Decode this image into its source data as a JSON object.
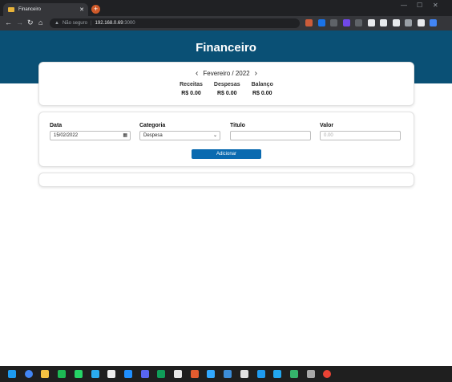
{
  "browser": {
    "tab_title": "Financeiro",
    "tab_close": "✕",
    "new_tab": "+",
    "window_controls": [
      "—",
      "☐",
      "✕"
    ],
    "nav": {
      "back": "←",
      "forward": "→",
      "reload": "↻",
      "home": "⌂"
    },
    "address": {
      "security_label": "Não seguro",
      "host": "192.168.0.69",
      "port": ":3000"
    },
    "extension_colors": [
      "#cc5c3a",
      "#1a73e8",
      "#5f6368",
      "#7048e8",
      "#5f6368",
      "#e8eaed",
      "#e8eaed",
      "#e8eaed",
      "#9aa0a6",
      "#e8eaed",
      "#4285f4"
    ]
  },
  "app": {
    "title": "Financeiro",
    "month_nav": {
      "prev": "‹",
      "label": "Fevereiro / 2022",
      "next": "›"
    },
    "summary": [
      {
        "label": "Receitas",
        "value": "R$ 0.00"
      },
      {
        "label": "Despesas",
        "value": "R$ 0.00"
      },
      {
        "label": "Balanço",
        "value": "R$ 0.00"
      }
    ],
    "form": {
      "date_label": "Data",
      "date_value": "15/02/2022",
      "category_label": "Categoria",
      "category_value": "Despesa",
      "title_label": "Titulo",
      "title_value": "",
      "value_label": "Valor",
      "value_placeholder": "0.00",
      "add_button": "Adicionar"
    }
  },
  "taskbar": {
    "icon_colors": [
      "#1d9bf0",
      "#4285f4",
      "#f5c242",
      "#1db954",
      "#25d366",
      "#2aabee",
      "#eeeeee",
      "#1f8fff",
      "#5865f2",
      "#0f9d58",
      "#e8e8e8",
      "#e55c2f",
      "#31a8ff",
      "#3c8dd8",
      "#e1e1e1",
      "#1e9bf0",
      "#22a7f0",
      "#35b46b",
      "#a8a8a8",
      "#ea4335"
    ]
  }
}
